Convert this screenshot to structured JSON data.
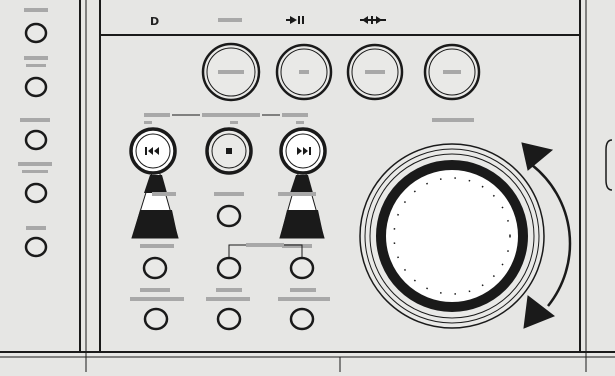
{
  "colors": {
    "background": "#e6e6e4",
    "line": "#1a1a1a",
    "label_bar": "#a8a8a8",
    "jog_fill": "#ffffff",
    "knob_fill": "#e9e9e7"
  },
  "transport": {
    "labels": [
      "D"
    ],
    "top_buttons": [
      {
        "name": "top-knob-1",
        "icon": "bar-glyph"
      },
      {
        "name": "top-knob-2",
        "icon": "bar-glyph"
      },
      {
        "name": "top-knob-3",
        "icon": "bar-glyph"
      },
      {
        "name": "top-knob-4",
        "icon": "bar-glyph"
      }
    ],
    "play_pause_icon": "play-pause-icon",
    "scrub_icon": "scrub-icon"
  },
  "deck": {
    "left_button_icon": "skip-back-icon",
    "center_button_icon": "stop-icon",
    "right_button_icon": "skip-forward-icon",
    "jog_wheel_icon": "jog-wheel-icon",
    "jog_arrow_icon": "rotate-arrow-icon"
  }
}
